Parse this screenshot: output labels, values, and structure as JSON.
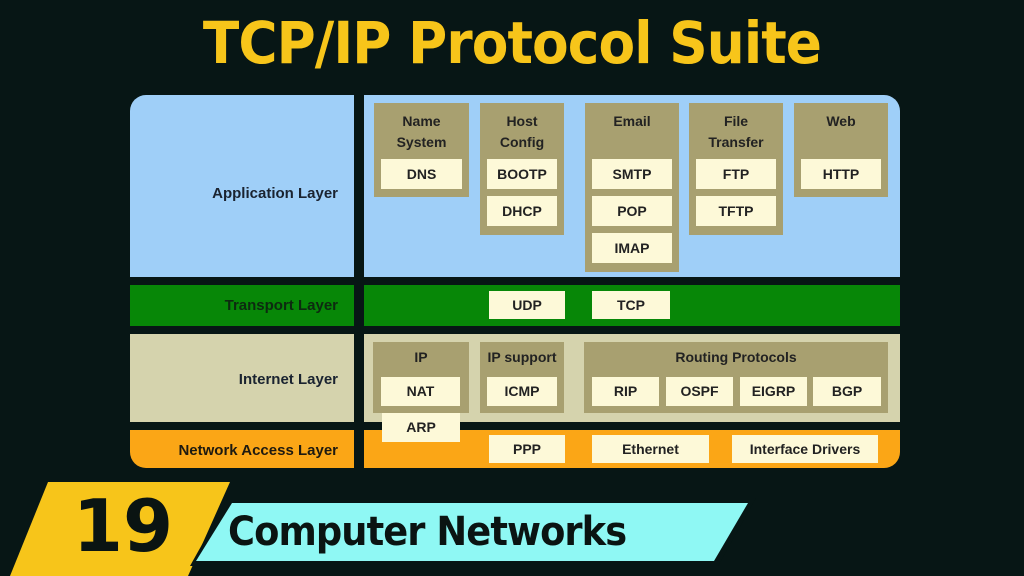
{
  "title": "TCP/IP Protocol Suite",
  "colors": {
    "background": "#071615",
    "title": "#f7c51a",
    "application": "#9fcff8",
    "transport": "#078707",
    "internet": "#d5d3ad",
    "network_access": "#fba616",
    "group": "#a8a070",
    "protocol_box": "#fdf9d8",
    "episode_tag": "#f7c51a",
    "series_tag": "#8ff8f4"
  },
  "layers": {
    "application": {
      "label": "Application Layer",
      "groups": [
        {
          "title_line1": "Name",
          "title_line2": "System",
          "protocols": [
            "DNS"
          ]
        },
        {
          "title_line1": "Host",
          "title_line2": "Config",
          "protocols": [
            "BOOTP",
            "DHCP"
          ]
        },
        {
          "title_line1": "Email",
          "title_line2": "",
          "protocols": [
            "SMTP",
            "POP",
            "IMAP"
          ]
        },
        {
          "title_line1": "File",
          "title_line2": "Transfer",
          "protocols": [
            "FTP",
            "TFTP"
          ]
        },
        {
          "title_line1": "Web",
          "title_line2": "",
          "protocols": [
            "HTTP"
          ]
        }
      ]
    },
    "transport": {
      "label": "Transport Layer",
      "protocols": [
        "UDP",
        "TCP"
      ]
    },
    "internet": {
      "label": "Internet Layer",
      "groups": [
        {
          "title": "IP",
          "protocols": [
            "NAT"
          ]
        },
        {
          "title": "IP support",
          "protocols": [
            "ICMP"
          ]
        },
        {
          "title": "Routing Protocols",
          "protocols": [
            "RIP",
            "OSPF",
            "EIGRP",
            "BGP"
          ]
        }
      ],
      "spanning_protocol": "ARP"
    },
    "network_access": {
      "label": "Network Access Layer",
      "protocols": [
        "PPP",
        "Ethernet",
        "Interface Drivers"
      ]
    }
  },
  "banner": {
    "episode_number": "19",
    "series_title": "Computer Networks"
  }
}
